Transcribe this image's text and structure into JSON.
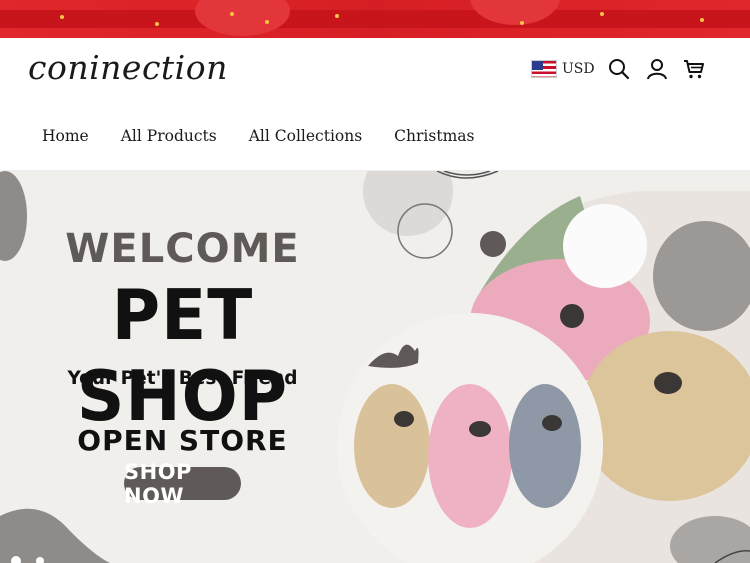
{
  "header": {
    "logo": "coninection",
    "currency": {
      "code": "USD",
      "flag_icon": "us-flag-icon"
    },
    "icons": [
      "search-icon",
      "account-icon",
      "cart-icon"
    ]
  },
  "nav": {
    "items": [
      {
        "label": "Home"
      },
      {
        "label": "All Products"
      },
      {
        "label": "All Collections"
      },
      {
        "label": "Christmas"
      }
    ]
  },
  "hero": {
    "welcome": "WELCOME",
    "title": "PET SHOP",
    "tagline": "Your Pet's Best Friend",
    "subtitle": "OPEN STORE",
    "cta_label": "SHOP NOW"
  },
  "colors": {
    "promo_red": "#e0272b",
    "hero_bg": "#f1efec",
    "button_gray": "#5f5a57",
    "accent_green": "#9aaf8e"
  }
}
